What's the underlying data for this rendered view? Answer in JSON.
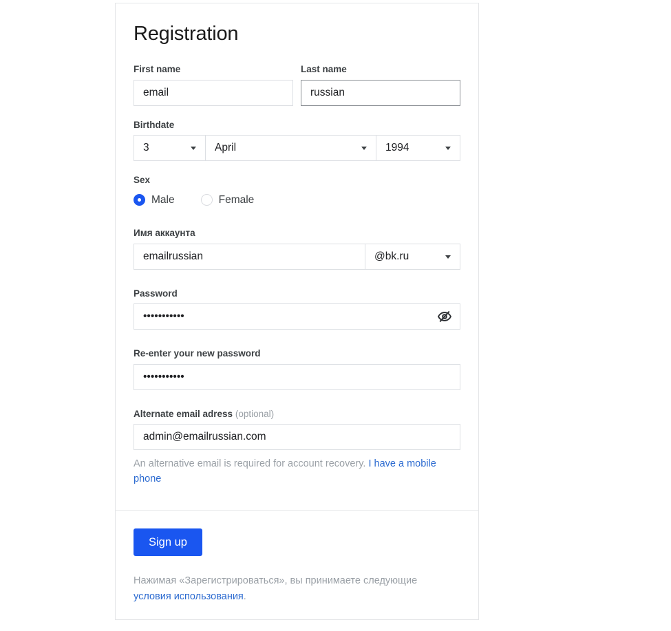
{
  "form": {
    "title": "Registration",
    "first_name": {
      "label": "First name",
      "value": "email",
      "placeholder": ""
    },
    "last_name": {
      "label": "Last name",
      "value": "russian",
      "placeholder": "",
      "focused": true,
      "caret_after_chars": 1
    },
    "birthdate": {
      "label": "Birthdate",
      "day": "3",
      "month": "April",
      "year": "1994"
    },
    "sex": {
      "label": "Sex",
      "options": [
        {
          "label": "Male",
          "selected": true
        },
        {
          "label": "Female",
          "selected": false
        }
      ]
    },
    "account_name": {
      "label": "Имя аккаунта",
      "value": "emailrussian",
      "domain": "@bk.ru"
    },
    "password": {
      "label": "Password",
      "value": "•••••••••••",
      "toggle_icon": "eye-slash-icon",
      "masked": true
    },
    "password_confirm": {
      "label": "Re-enter your new password",
      "value": "•••••••••••"
    },
    "alternate_email": {
      "label": "Alternate email adress",
      "label_optional": "(optional)",
      "value": "admin@emailrussian.com",
      "helper_prefix": "An alternative email is required for account recovery. ",
      "helper_link": "I have a mobile phone"
    }
  },
  "footer": {
    "signup_label": "Sign up",
    "terms_prefix": "Нажимая «Зарегистрироваться», вы принимаете следующие ",
    "terms_link": "условия использования",
    "terms_suffix": "."
  },
  "colors": {
    "accent": "#1a56f0",
    "link": "#2b6ad0",
    "label": "#3c4043",
    "muted": "#9aa0a6",
    "border": "#dcdfe3",
    "border_focus": "#8a8f94"
  }
}
